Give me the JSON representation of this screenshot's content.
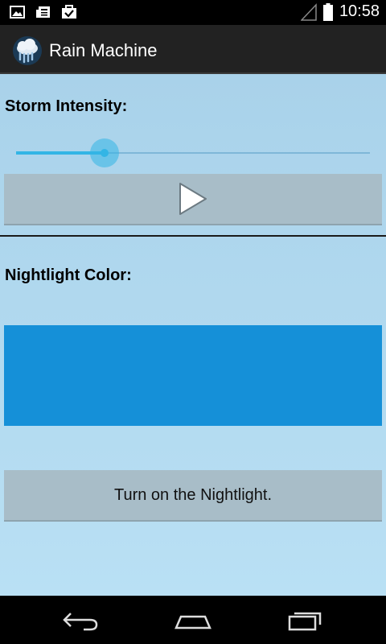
{
  "status_bar": {
    "time": "10:58",
    "icons": [
      "image-icon",
      "news-icon",
      "task-check-icon",
      "signal-icon",
      "battery-icon"
    ]
  },
  "action_bar": {
    "title": "Rain Machine",
    "icon": "rain-cloud-icon"
  },
  "storm": {
    "label": "Storm Intensity:",
    "slider_value": 0.25,
    "play_icon": "play-icon"
  },
  "nightlight": {
    "label": "Nightlight Color:",
    "color": "#1590d8",
    "button_label": "Turn on the Nightlight."
  },
  "nav_bar": {
    "icons": [
      "back-icon",
      "home-icon",
      "recent-apps-icon"
    ]
  },
  "colors": {
    "accent": "#33b5e5",
    "background": "#b2daef",
    "button": "#a8bdc8"
  }
}
